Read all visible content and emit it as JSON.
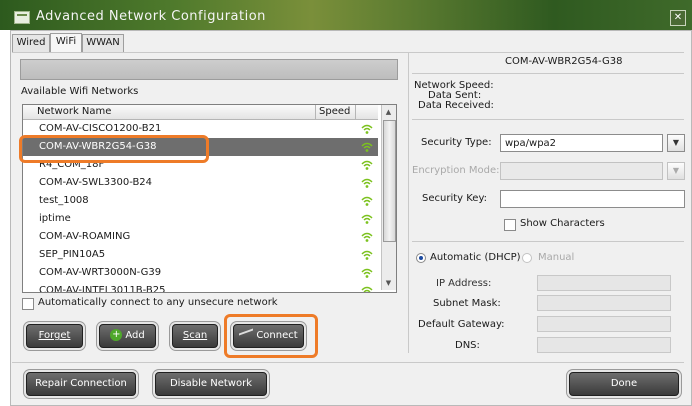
{
  "window": {
    "title": "Advanced Network Configuration",
    "close_glyph": "✕"
  },
  "tabs": [
    {
      "label": "Wired",
      "active": false
    },
    {
      "label": "WiFi",
      "active": true
    },
    {
      "label": "WWAN",
      "active": false
    }
  ],
  "wifi": {
    "available_label": "Available Wifi Networks",
    "columns": {
      "name": "Network Name",
      "speed": "Speed"
    },
    "networks": [
      {
        "name": "COM-AV-CISCO1200-B21",
        "selected": false
      },
      {
        "name": "COM-AV-WBR2G54-G38",
        "selected": true
      },
      {
        "name": "R4_COM_18F",
        "selected": false
      },
      {
        "name": "COM-AV-SWL3300-B24",
        "selected": false
      },
      {
        "name": "test_1008",
        "selected": false
      },
      {
        "name": "iptime",
        "selected": false
      },
      {
        "name": "COM-AV-ROAMING",
        "selected": false
      },
      {
        "name": "SEP_PIN10A5",
        "selected": false
      },
      {
        "name": "COM-AV-WRT3000N-G39",
        "selected": false
      },
      {
        "name": "COM-AV-INTEL3011B-B25",
        "selected": false
      }
    ],
    "auto_connect_label": "Automatically connect to any unsecure network",
    "auto_connect_checked": false,
    "buttons": {
      "forget": "Forget",
      "add": "Add",
      "scan": "Scan",
      "connect": "Connect"
    },
    "signal_icon": "wifi-signal-icon",
    "signal_color": "#7cc21e"
  },
  "details": {
    "network_title": "COM-AV-WBR2G54-G38",
    "speed_label": "Network Speed:",
    "sent_label": "Data Sent:",
    "received_label": "Data Received:",
    "security_type_label": "Security Type:",
    "security_type_value": "wpa/wpa2",
    "encryption_mode_label": "Encryption Mode:",
    "encryption_mode_value": "",
    "security_key_label": "Security Key:",
    "security_key_value": "",
    "show_characters_label": "Show Characters",
    "automatic_label": "Automatic (DHCP)",
    "manual_label": "Manual",
    "ip_label": "IP Address:",
    "subnet_label": "Subnet Mask:",
    "gateway_label": "Default Gateway:",
    "dns_label": "DNS:"
  },
  "footer": {
    "repair": "Repair Connection",
    "disable": "Disable Network",
    "done": "Done"
  },
  "colors": {
    "highlight": "#ee7b28",
    "button_dark": "#3a3a3a",
    "selected_row": "#6e6e6e"
  }
}
